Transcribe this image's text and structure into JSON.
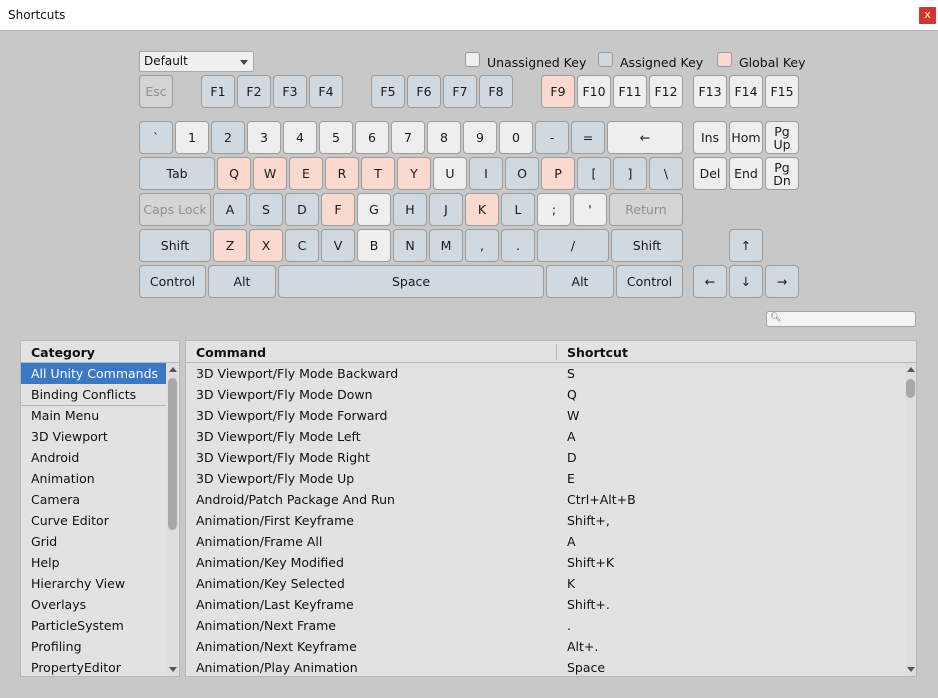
{
  "window": {
    "title": "Shortcuts",
    "close_label": "x"
  },
  "profile": {
    "selected": "Default"
  },
  "legend": {
    "unassigned": "Unassigned Key",
    "assigned": "Assigned Key",
    "global": "Global Key"
  },
  "colors": {
    "unassigned": "#eeeeee",
    "assigned": "#cfd9df",
    "global": "#fad9cf",
    "selection": "#3b78c4"
  },
  "keyboard": {
    "esc": "Esc",
    "f1": "F1",
    "f2": "F2",
    "f3": "F3",
    "f4": "F4",
    "f5": "F5",
    "f6": "F6",
    "f7": "F7",
    "f8": "F8",
    "f9": "F9",
    "f10": "F10",
    "f11": "F11",
    "f12": "F12",
    "f13": "F13",
    "f14": "F14",
    "f15": "F15",
    "backquote": "`",
    "d1": "1",
    "d2": "2",
    "d3": "3",
    "d4": "4",
    "d5": "5",
    "d6": "6",
    "d7": "7",
    "d8": "8",
    "d9": "9",
    "d0": "0",
    "minus": "-",
    "equals": "=",
    "backspace": "←",
    "tab": "Tab",
    "q": "Q",
    "w": "W",
    "e": "E",
    "r": "R",
    "t": "T",
    "y": "Y",
    "u": "U",
    "i": "I",
    "o": "O",
    "p": "P",
    "lbracket": "[",
    "rbracket": "]",
    "backslash": "\\",
    "capslock": "Caps Lock",
    "a": "A",
    "s": "S",
    "d": "D",
    "f": "F",
    "g": "G",
    "h": "H",
    "j": "J",
    "k": "K",
    "l": "L",
    "semicolon": ";",
    "quote": "'",
    "return": "Return",
    "lshift": "Shift",
    "z": "Z",
    "x": "X",
    "c": "C",
    "v": "V",
    "b": "B",
    "n": "N",
    "m": "M",
    "comma": ",",
    "period": ".",
    "slash": "/",
    "rshift": "Shift",
    "lcontrol": "Control",
    "lalt": "Alt",
    "space": "Space",
    "ralt": "Alt",
    "rcontrol": "Control",
    "ins": "Ins",
    "home": "Hom",
    "pgup": "Pg Up",
    "del": "Del",
    "end": "End",
    "pgdn": "Pg Dn",
    "up": "↑",
    "left": "←",
    "down": "↓",
    "right": "→"
  },
  "category_panel": {
    "header": "Category",
    "items": [
      "All Unity Commands",
      "Binding Conflicts",
      "Main Menu",
      "3D Viewport",
      "Android",
      "Animation",
      "Camera",
      "Curve Editor",
      "Grid",
      "Help",
      "Hierarchy View",
      "Overlays",
      "ParticleSystem",
      "Profiling",
      "PropertyEditor"
    ]
  },
  "command_panel": {
    "headers": {
      "command": "Command",
      "shortcut": "Shortcut"
    },
    "rows": [
      {
        "command": "3D Viewport/Fly Mode Backward",
        "shortcut": "S"
      },
      {
        "command": "3D Viewport/Fly Mode Down",
        "shortcut": "Q"
      },
      {
        "command": "3D Viewport/Fly Mode Forward",
        "shortcut": "W"
      },
      {
        "command": "3D Viewport/Fly Mode Left",
        "shortcut": "A"
      },
      {
        "command": "3D Viewport/Fly Mode Right",
        "shortcut": "D"
      },
      {
        "command": "3D Viewport/Fly Mode Up",
        "shortcut": "E"
      },
      {
        "command": "Android/Patch Package And Run",
        "shortcut": "Ctrl+Alt+B"
      },
      {
        "command": "Animation/First Keyframe",
        "shortcut": "Shift+,"
      },
      {
        "command": "Animation/Frame All",
        "shortcut": "A"
      },
      {
        "command": "Animation/Key Modified",
        "shortcut": "Shift+K"
      },
      {
        "command": "Animation/Key Selected",
        "shortcut": "K"
      },
      {
        "command": "Animation/Last Keyframe",
        "shortcut": "Shift+."
      },
      {
        "command": "Animation/Next Frame",
        "shortcut": "."
      },
      {
        "command": "Animation/Next Keyframe",
        "shortcut": "Alt+."
      },
      {
        "command": "Animation/Play Animation",
        "shortcut": "Space"
      }
    ]
  }
}
